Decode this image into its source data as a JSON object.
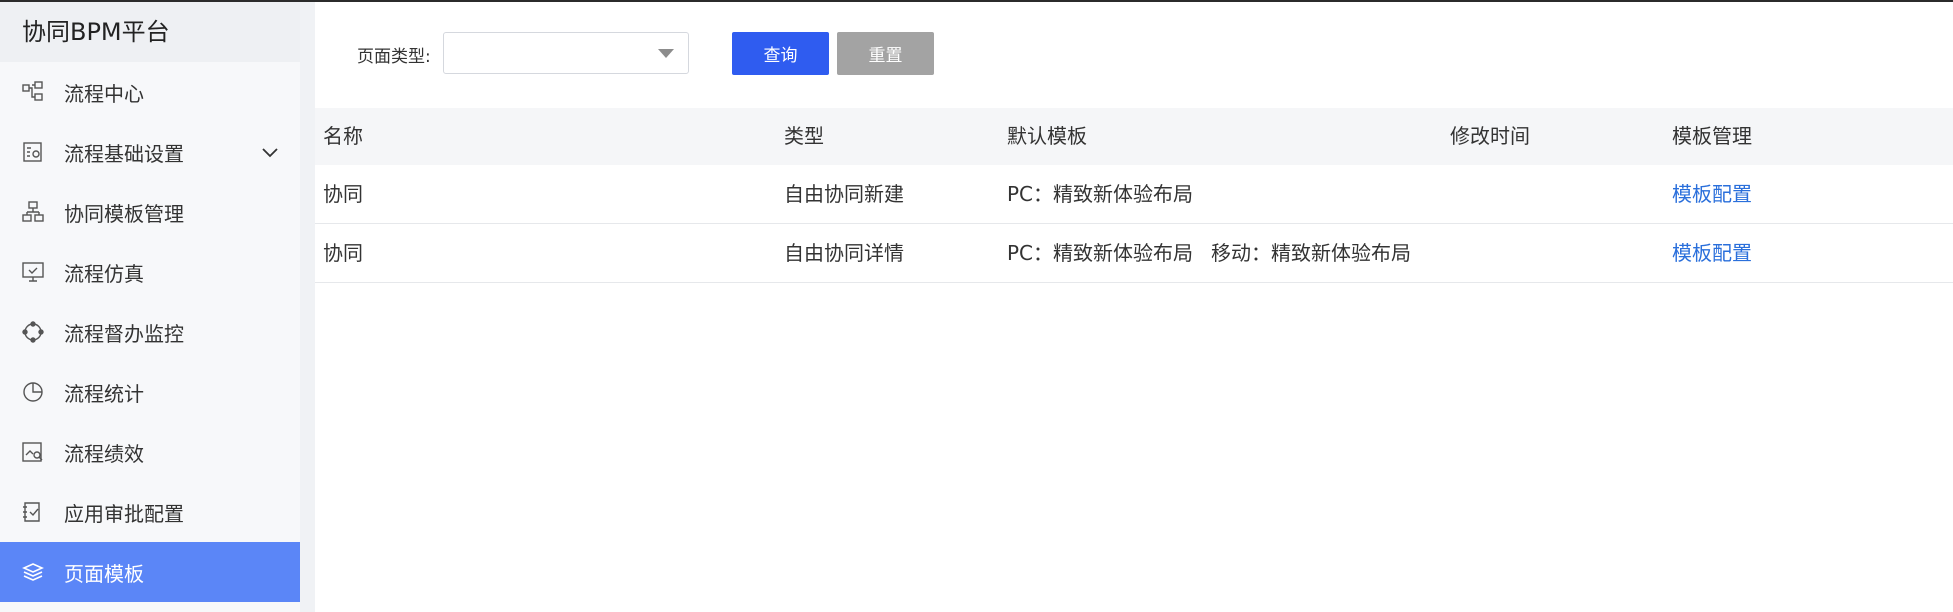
{
  "sidebar": {
    "brand": "协同BPM平台",
    "items": [
      {
        "label": "流程中心",
        "icon": "flow-center-icon"
      },
      {
        "label": "流程基础设置",
        "icon": "flow-settings-icon",
        "expandable": true
      },
      {
        "label": "协同模板管理",
        "icon": "template-manage-icon"
      },
      {
        "label": "流程仿真",
        "icon": "monitor-icon"
      },
      {
        "label": "流程督办监控",
        "icon": "monitor-cycle-icon"
      },
      {
        "label": "流程统计",
        "icon": "pie-chart-icon"
      },
      {
        "label": "流程绩效",
        "icon": "performance-icon"
      },
      {
        "label": "应用审批配置",
        "icon": "approval-config-icon"
      },
      {
        "label": "页面模板",
        "icon": "layers-icon",
        "active": true
      }
    ],
    "active_color": "#5b86f7"
  },
  "filter": {
    "page_type_label": "页面类型:",
    "page_type_value": "",
    "query_label": "查询",
    "reset_label": "重置"
  },
  "table": {
    "columns": [
      "名称",
      "类型",
      "默认模板",
      "修改时间",
      "模板管理"
    ],
    "rows": [
      {
        "name": "协同",
        "type": "自由协同新建",
        "default_template_pc": "PC：精致新体验布局",
        "default_template_mobile": "",
        "modified": "",
        "action": "模板配置"
      },
      {
        "name": "协同",
        "type": "自由协同详情",
        "default_template_pc": "PC：精致新体验布局",
        "default_template_mobile": "移动：精致新体验布局",
        "modified": "",
        "action": "模板配置"
      }
    ]
  },
  "colors": {
    "primary": "#2f5cf0",
    "link": "#2a6fdb",
    "reset": "#a3a3a3"
  }
}
